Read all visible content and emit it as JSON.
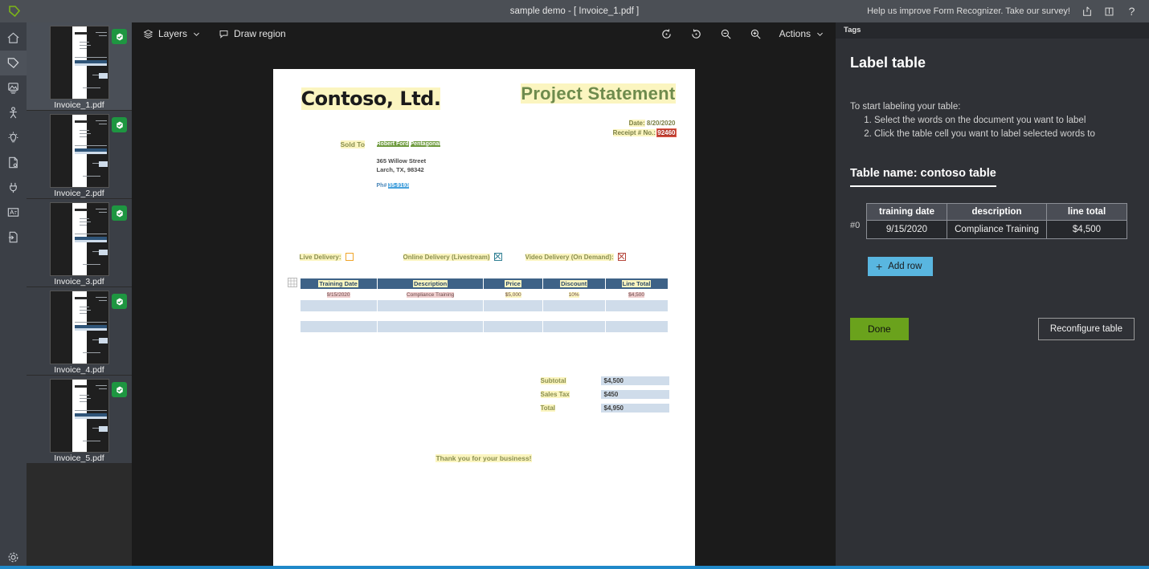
{
  "titlebar": {
    "app_logo_icon": "tag-icon",
    "title": "sample demo - [ Invoice_1.pdf ]",
    "survey_text": "Help us improve Form Recognizer. Take our survey!",
    "share_icon": "share-icon",
    "book_icon": "book-icon",
    "help_icon": "question-mark-icon"
  },
  "rail": {
    "items": [
      {
        "name": "home",
        "icon": "home-icon",
        "active": false
      },
      {
        "name": "tags",
        "icon": "tag-icon",
        "active": true
      },
      {
        "name": "train",
        "icon": "layers-image-icon",
        "active": false
      },
      {
        "name": "model-compose",
        "icon": "person-icon",
        "active": false
      },
      {
        "name": "predict",
        "icon": "lightbulb-icon",
        "active": false
      },
      {
        "name": "document-settings",
        "icon": "document-gear-icon",
        "active": false
      },
      {
        "name": "connections",
        "icon": "plug-icon",
        "active": false
      },
      {
        "name": "business-card",
        "icon": "id-card-icon",
        "active": false
      },
      {
        "name": "document-export",
        "icon": "document-export-icon",
        "active": false
      }
    ],
    "settings_icon": "gear-icon"
  },
  "thumbnails": [
    {
      "label": "Invoice_1.pdf",
      "selected": true,
      "badge_icon": "tagged-badge-icon"
    },
    {
      "label": "Invoice_2.pdf",
      "selected": false,
      "badge_icon": "tagged-badge-icon"
    },
    {
      "label": "Invoice_3.pdf",
      "selected": false,
      "badge_icon": "tagged-badge-icon"
    },
    {
      "label": "Invoice_4.pdf",
      "selected": false,
      "badge_icon": "tagged-badge-icon"
    },
    {
      "label": "Invoice_5.pdf",
      "selected": false,
      "badge_icon": "tagged-badge-icon"
    }
  ],
  "toolbar": {
    "layers_label": "Layers",
    "layers_icon": "layers-icon",
    "layers_chevron_icon": "chevron-down-icon",
    "draw_region_label": "Draw region",
    "draw_region_icon": "region-icon",
    "rotate_left_icon": "rotate-left-icon",
    "rotate_right_icon": "rotate-right-icon",
    "zoom_out_icon": "zoom-out-icon",
    "zoom_in_icon": "zoom-in-icon",
    "actions_label": "Actions",
    "actions_chevron_icon": "chevron-down-icon"
  },
  "document": {
    "company": "Contoso, Ltd.",
    "statement_title": "Project Statement",
    "date_label": "Date:",
    "date_value": "8/20/2020",
    "receipt_label": "Receipt # No.:",
    "receipt_value": "92460",
    "sold_to_label": "Sold To",
    "customer_name": "Robert Ford",
    "customer_company": "Pentagonal",
    "address_line1": "365 Willow Street",
    "address_line2": "Larch, TX, 98342",
    "phone_label": "Ph#",
    "phone_value": "35-9193",
    "delivery": [
      {
        "label": "Live Delivery:",
        "checkbox": "unchecked",
        "color": "#f0a52a"
      },
      {
        "label": "Online Delivery (Livestream)",
        "checkbox": "checked",
        "color": "#2f7f93"
      },
      {
        "label": "Video Delivery (On Demand):",
        "checkbox": "checked",
        "color": "#b5453a"
      }
    ],
    "table": {
      "headers": [
        "Training Date",
        "Description",
        "Price",
        "Discount",
        "Line Total"
      ],
      "rows": [
        [
          "9/15/2020",
          "Compliance Training",
          "$5,000",
          "10%",
          "$4,500"
        ]
      ],
      "empty_rows": 2
    },
    "totals": [
      {
        "label": "Subtotal",
        "value": "$4,500"
      },
      {
        "label": "Sales Tax",
        "value": "$450"
      },
      {
        "label": "Total",
        "value": "$4,950"
      }
    ],
    "footer": "Thank you for your business!"
  },
  "right_panel": {
    "tags_header": "Tags",
    "title": "Label table",
    "instructions_intro": "To start labeling your table:",
    "instructions": [
      "Select the words on the document you want to label",
      "Click the table cell you want to label selected words to"
    ],
    "table_name": "Table name: contoso table",
    "label_table": {
      "headers": [
        "training date",
        "description",
        "line total"
      ],
      "rows": [
        {
          "index": "#0",
          "cells": [
            "9/15/2020",
            "Compliance Training",
            "$4,500"
          ]
        }
      ]
    },
    "add_row_label": "Add row",
    "add_row_icon": "plus-icon",
    "done_label": "Done",
    "reconfigure_label": "Reconfigure table"
  },
  "colors": {
    "accent_blue": "#2089c9",
    "done_green": "#6aa21c",
    "add_row_blue": "#59b6e0",
    "badge_green": "#1e9641",
    "highlight_yellow": "#fbf5c0",
    "table_header_blue": "#3e6287"
  }
}
